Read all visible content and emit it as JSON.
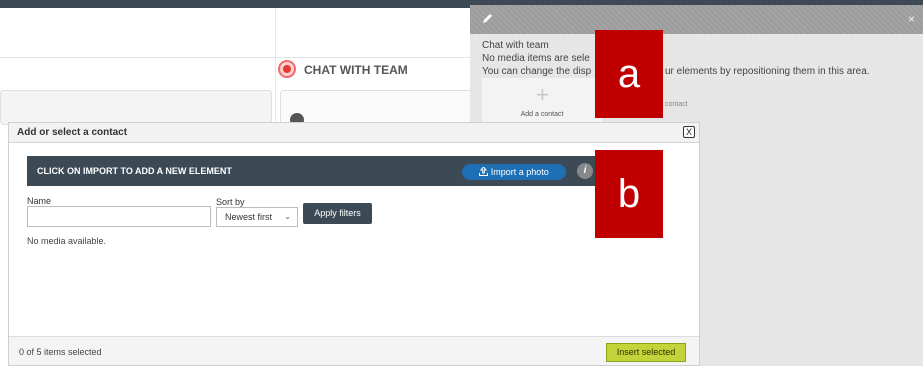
{
  "background": {
    "chat_title": "CHAT WITH TEAM"
  },
  "right_panel": {
    "close_glyph": "×",
    "edit_icon": "pencil-icon",
    "line1": "Chat with team",
    "line2": "No media items are sele",
    "line3_left": "You can change the disp",
    "line3_right": "ur elements by repositioning them in this area.",
    "add_contact_label": "Add a contact",
    "ghost_label": "contact"
  },
  "modal": {
    "title": "Add or select a contact",
    "close_glyph": "X",
    "band_text": "CLICK ON IMPORT TO ADD A NEW ELEMENT",
    "import_label": "Import a photo",
    "import_icon": "upload-icon",
    "info_glyph": "i",
    "name_label": "Name",
    "name_value": "",
    "sort_label": "Sort by",
    "sort_value": "Newest first",
    "apply_label": "Apply filters",
    "empty_text": "No media available.",
    "selection_count": "0 of 5 items selected",
    "insert_label": "Insert selected"
  },
  "callouts": {
    "a": "a",
    "b": "b"
  },
  "colors": {
    "band": "#3b4a55",
    "import_button": "#1f6fb5",
    "insert_button": "#c3d43a",
    "callout": "#c00000",
    "chat_dot": "#e53935"
  }
}
